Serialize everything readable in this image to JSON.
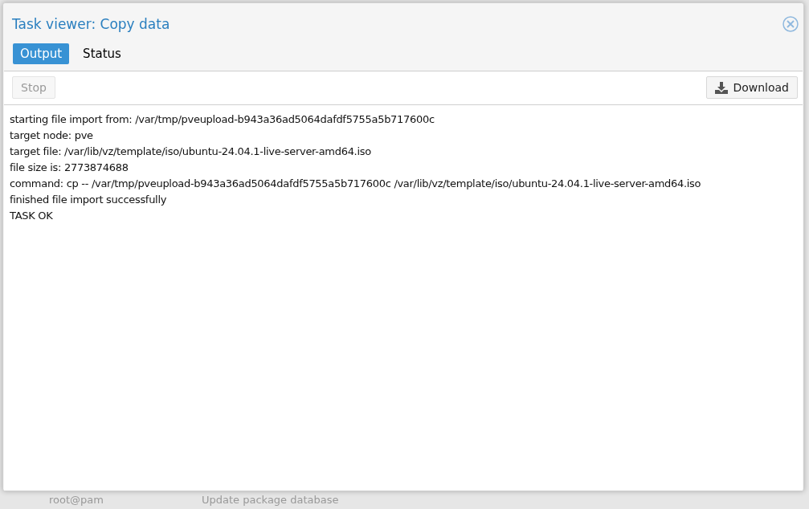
{
  "window": {
    "title": "Task viewer: Copy data"
  },
  "tabs": [
    {
      "label": "Output",
      "selected": true
    },
    {
      "label": "Status",
      "selected": false
    }
  ],
  "toolbar": {
    "buttons": [
      {
        "kind": "stop",
        "label": "Stop",
        "disabled": true
      },
      {
        "kind": "download",
        "label": "Download",
        "disabled": false
      }
    ]
  },
  "log": [
    "starting file import from: /var/tmp/pveupload-b943a36ad5064dafdf5755a5b717600c",
    "target node: pve",
    "target file: /var/lib/vz/template/iso/ubuntu-24.04.1-live-server-amd64.iso",
    "file size is: 2773874688",
    "command: cp -- /var/tmp/pveupload-b943a36ad5064dafdf5755a5b717600c /var/lib/vz/template/iso/ubuntu-24.04.1-live-server-amd64.iso",
    "finished file import successfully",
    "TASK OK"
  ],
  "background_row": [
    "root@pam",
    "Update package database"
  ]
}
